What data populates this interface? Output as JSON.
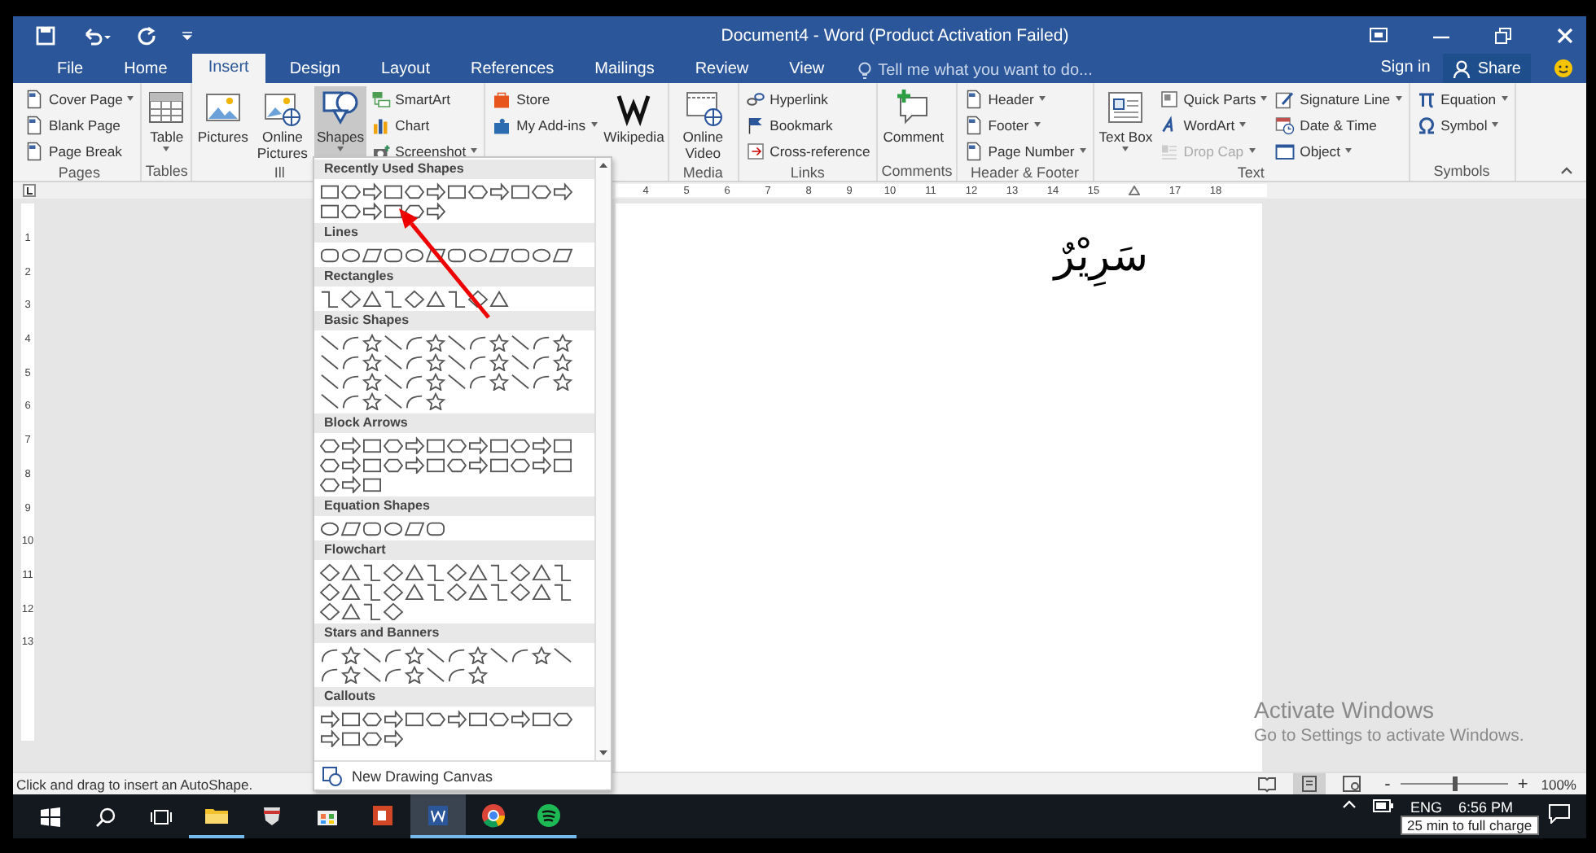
{
  "title_bar": {
    "title": "Document4 - Word (Product Activation Failed)"
  },
  "ribbon_tabs": [
    {
      "label": "File",
      "selected": false
    },
    {
      "label": "Home",
      "selected": false
    },
    {
      "label": "Insert",
      "selected": true
    },
    {
      "label": "Design",
      "selected": false
    },
    {
      "label": "Layout",
      "selected": false
    },
    {
      "label": "References",
      "selected": false
    },
    {
      "label": "Mailings",
      "selected": false
    },
    {
      "label": "Review",
      "selected": false
    },
    {
      "label": "View",
      "selected": false
    }
  ],
  "tell_me": {
    "placeholder": "Tell me what you want to do..."
  },
  "account": {
    "sign_in": "Sign in",
    "share": "Share"
  },
  "ribbon_groups": [
    {
      "label": "Pages",
      "columns": [
        {
          "kind": "stack",
          "items": [
            {
              "label": "Cover Page",
              "dropdown": true,
              "selected": false,
              "disabled": false
            },
            {
              "label": "Blank Page",
              "dropdown": false,
              "selected": false,
              "disabled": false
            },
            {
              "label": "Page Break",
              "dropdown": false,
              "selected": false,
              "disabled": false
            }
          ]
        }
      ]
    },
    {
      "label": "Tables",
      "columns": [
        {
          "kind": "large",
          "items": [
            {
              "label": "Table",
              "dropdown": true,
              "selected": false,
              "disabled": false
            }
          ]
        }
      ]
    },
    {
      "label": "Ill",
      "columns": [
        {
          "kind": "large",
          "items": [
            {
              "label": "Pictures",
              "dropdown": false,
              "selected": false,
              "disabled": false
            }
          ]
        },
        {
          "kind": "large",
          "items": [
            {
              "label": "Online Pictures",
              "dropdown": false,
              "selected": false,
              "disabled": false
            }
          ]
        },
        {
          "kind": "large",
          "items": [
            {
              "label": "Shapes",
              "dropdown": true,
              "selected": true,
              "disabled": false
            }
          ]
        },
        {
          "kind": "stack",
          "items": [
            {
              "label": "SmartArt",
              "dropdown": false,
              "selected": false,
              "disabled": false
            },
            {
              "label": "Chart",
              "dropdown": false,
              "selected": false,
              "disabled": false
            },
            {
              "label": "Screenshot",
              "dropdown": true,
              "selected": false,
              "disabled": false
            }
          ]
        }
      ]
    },
    {
      "columns": [
        {
          "kind": "stack",
          "items": [
            {
              "label": "Store",
              "dropdown": false,
              "selected": false,
              "disabled": false
            },
            {
              "label": "My Add-ins",
              "dropdown": true,
              "selected": false,
              "disabled": false
            }
          ]
        },
        {
          "kind": "large",
          "items": [
            {
              "label": "Wikipedia",
              "dropdown": false,
              "selected": false,
              "disabled": false
            }
          ]
        }
      ]
    },
    {
      "label": "Media",
      "columns": [
        {
          "kind": "large",
          "items": [
            {
              "label": "Online Video",
              "dropdown": false,
              "selected": false,
              "disabled": false
            }
          ]
        }
      ]
    },
    {
      "label": "Links",
      "columns": [
        {
          "kind": "stack",
          "items": [
            {
              "label": "Hyperlink",
              "dropdown": false,
              "selected": false,
              "disabled": false
            },
            {
              "label": "Bookmark",
              "dropdown": false,
              "selected": false,
              "disabled": false
            },
            {
              "label": "Cross-reference",
              "dropdown": false,
              "selected": false,
              "disabled": false
            }
          ]
        }
      ]
    },
    {
      "label": "Comments",
      "columns": [
        {
          "kind": "large",
          "items": [
            {
              "label": "Comment",
              "dropdown": false,
              "selected": false,
              "disabled": false
            }
          ]
        }
      ]
    },
    {
      "label": "Header & Footer",
      "columns": [
        {
          "kind": "stack",
          "items": [
            {
              "label": "Header",
              "dropdown": true,
              "selected": false,
              "disabled": false
            },
            {
              "label": "Footer",
              "dropdown": true,
              "selected": false,
              "disabled": false
            },
            {
              "label": "Page Number",
              "dropdown": true,
              "selected": false,
              "disabled": false
            }
          ]
        }
      ]
    },
    {
      "label": "Text",
      "columns": [
        {
          "kind": "large",
          "items": [
            {
              "label": "Text Box",
              "dropdown": true,
              "selected": false,
              "disabled": false
            }
          ]
        },
        {
          "kind": "stack",
          "items": [
            {
              "label": "Quick Parts",
              "dropdown": true,
              "selected": false,
              "disabled": false
            },
            {
              "label": "WordArt",
              "dropdown": true,
              "selected": false,
              "disabled": false
            },
            {
              "label": "Drop Cap",
              "dropdown": true,
              "selected": false,
              "disabled": true
            }
          ]
        },
        {
          "kind": "stack",
          "items": [
            {
              "label": "Signature Line",
              "dropdown": true,
              "selected": false,
              "disabled": false
            },
            {
              "label": "Date & Time",
              "dropdown": false,
              "selected": false,
              "disabled": false
            },
            {
              "label": "Object",
              "dropdown": true,
              "selected": false,
              "disabled": false
            }
          ]
        }
      ]
    },
    {
      "label": "Symbols",
      "columns": [
        {
          "kind": "stack",
          "items": [
            {
              "label": "Equation",
              "dropdown": true,
              "selected": false,
              "disabled": false
            },
            {
              "label": "Symbol",
              "dropdown": true,
              "selected": false,
              "disabled": false
            }
          ]
        }
      ]
    }
  ],
  "shapes_menu": {
    "sections": [
      {
        "title": "Recently Used Shapes"
      },
      {
        "title": "Lines"
      },
      {
        "title": "Rectangles"
      },
      {
        "title": "Basic Shapes"
      },
      {
        "title": "Block Arrows"
      },
      {
        "title": "Equation Shapes"
      },
      {
        "title": "Flowchart"
      },
      {
        "title": "Stars and Banners"
      },
      {
        "title": "Callouts"
      }
    ],
    "footer": "New Drawing Canvas"
  },
  "document": {
    "ruler_numbers": [
      "4",
      "5",
      "6",
      "7",
      "8",
      "9",
      "10",
      "11",
      "12",
      "13",
      "14",
      "15",
      "17",
      "18"
    ],
    "vertical_ruler_numbers": [
      "1",
      "2",
      "3",
      "4",
      "5",
      "6",
      "7",
      "8",
      "9",
      "10",
      "11",
      "12",
      "13"
    ],
    "text": "سَرِيْرٌ"
  },
  "activation_notice": {
    "title": "Activate Windows",
    "subtitle": "Go to Settings to activate Windows."
  },
  "status_bar": {
    "message": "Click and drag to insert an AutoShape.",
    "views": [
      {
        "selected": false
      },
      {
        "selected": true
      },
      {
        "selected": false
      }
    ],
    "zoom": {
      "minus": "-",
      "plus": "+",
      "level": 0.5,
      "reading": "100%"
    }
  },
  "taskbar": {
    "apps": [
      {
        "running": true,
        "selected": false
      },
      {
        "running": false,
        "selected": false
      },
      {
        "running": false,
        "selected": false
      },
      {
        "running": false,
        "selected": false
      },
      {
        "running": true,
        "selected": true
      },
      {
        "running": true,
        "selected": false
      },
      {
        "running": true,
        "selected": false
      }
    ],
    "language": "ENG",
    "time": "6:56 PM",
    "tooltip": "25 min to full charge"
  }
}
